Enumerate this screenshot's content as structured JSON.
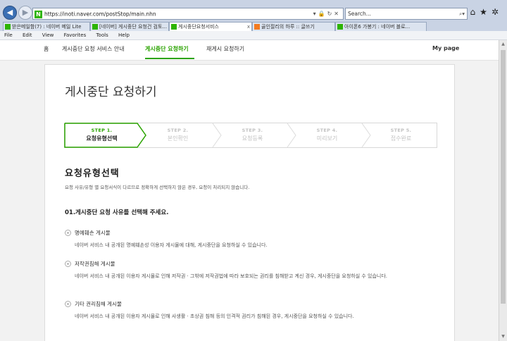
{
  "browser": {
    "address": "https://inoti.naver.com/postStop/main.nhn",
    "search_placeholder": "Search...",
    "tabs": [
      {
        "label": "받은메일함(7) : 네이버 메일 Lite",
        "icon": "naver-favicon-icon",
        "active": false
      },
      {
        "label": "[네이버] 게시중단 요청건 검토...",
        "icon": "naver-favicon-icon",
        "active": false
      },
      {
        "label": "게시중단요청서비스",
        "icon": "naver-favicon-icon",
        "active": true
      },
      {
        "label": "골인절리의 하루 :: 글쓰기",
        "icon": "tistory-favicon-icon",
        "active": false
      },
      {
        "label": "아이폰6 가봉기 : 네이버 블로...",
        "icon": "naver-favicon-icon",
        "active": false
      }
    ],
    "menu": [
      "File",
      "Edit",
      "View",
      "Favorites",
      "Tools",
      "Help"
    ]
  },
  "site_nav": {
    "items": [
      "홈",
      "게시중단 요청 서비스 안내",
      "게시중단 요청하기",
      "재게시 요청하기"
    ],
    "current": "게시중단 요청하기",
    "mypage": "My page"
  },
  "page": {
    "title": "게시중단 요청하기",
    "steps": [
      {
        "label": "STEP 1.",
        "name": "요청유형선택",
        "active": true
      },
      {
        "label": "STEP 2.",
        "name": "본인확인",
        "active": false
      },
      {
        "label": "STEP 3.",
        "name": "요청등록",
        "active": false
      },
      {
        "label": "STEP 4.",
        "name": "미리보기",
        "active": false
      },
      {
        "label": "STEP 5.",
        "name": "접수완료",
        "active": false
      }
    ],
    "section_title": "요청유형선택",
    "section_desc": "요청 사유/유형 별 요청서식이 다르므로 정확하게 선택하지 않은 경우, 요청이 처리되지 않습니다.",
    "question": "01.게시중단 요청 사유를 선택해 주세요.",
    "options": [
      {
        "label": "명예훼손 게시물",
        "desc": "네이버 서비스 내 공개된 명예훼손성 이용자 게시물에 대해, 게시중단을 요청하실 수 있습니다."
      },
      {
        "label": "저작권침해 게시물",
        "desc": "네이버 서비스 내 공개된 이용자 게시물로 인해 저작권 · 그밖에 저작권법에 따라 보호되는 권리를 침해받고 계신 경우, 게시중단을 요청하실 수 있습니다."
      },
      {
        "label": "기타 권리침해 게시물",
        "desc": "네이버 서비스 내 공개된 이용자 게시물로 인해 사생활 · 초상권 침해 등의 인격적 권리가 침해된 경우, 게시중단을 요청하실 수 있습니다."
      }
    ]
  }
}
